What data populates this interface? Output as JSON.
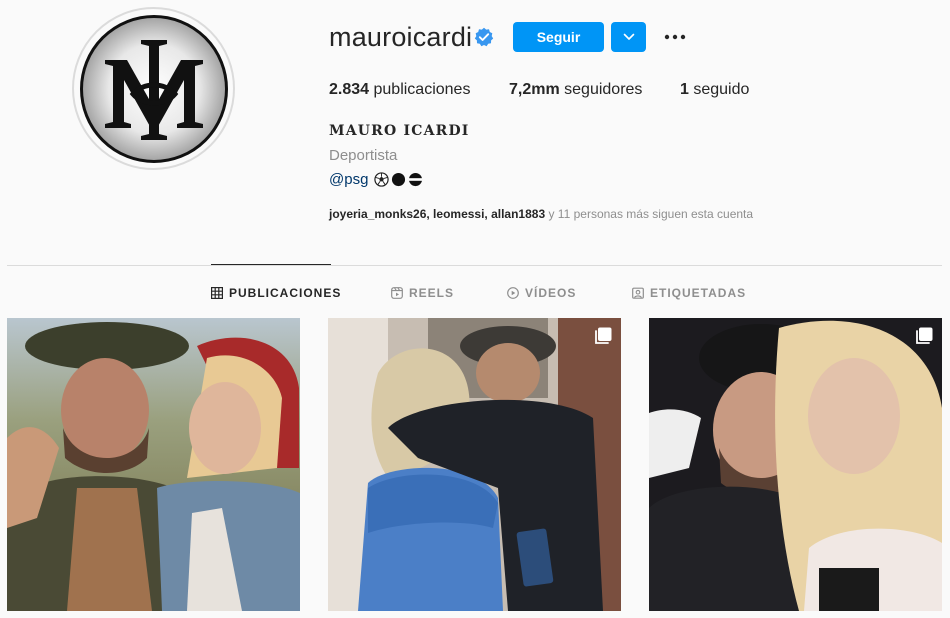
{
  "profile": {
    "username": "mauroicardi",
    "full_name": "MAURO ICARDI",
    "category": "Deportista",
    "bio_link": "@psg",
    "bio_emoji": [
      "soccer-ball-icon",
      "black-circle-icon",
      "black-white-circle-icon"
    ],
    "avatar_icon": "mi-monogram-logo",
    "verified_icon": "verified-badge-icon"
  },
  "actions": {
    "follow_label": "Seguir",
    "suggest_icon": "chevron-down-icon",
    "more_icon": "more-options-icon"
  },
  "stats": {
    "posts_value": "2.834",
    "posts_label": " publicaciones",
    "followers_value": "7,2mm",
    "followers_label": " seguidores",
    "following_value": "1",
    "following_label": " seguido"
  },
  "followed_by": {
    "names": "joyeria_monks26, leomessi, allan1883",
    "suffix": " y 11 personas más siguen esta cuenta"
  },
  "tabs": [
    {
      "label": "PUBLICACIONES",
      "icon": "grid-icon",
      "active": true
    },
    {
      "label": "REELS",
      "icon": "reels-icon",
      "active": false
    },
    {
      "label": "VÍDEOS",
      "icon": "play-icon",
      "active": false
    },
    {
      "label": "ETIQUETADAS",
      "icon": "tagged-icon",
      "active": false
    }
  ],
  "posts": [
    {
      "multi": false,
      "icon": ""
    },
    {
      "multi": true,
      "icon": "carousel-icon"
    },
    {
      "multi": true,
      "icon": "carousel-icon"
    }
  ],
  "colors": {
    "accent": "#0095f6",
    "background": "#fafafa",
    "text": "#262626",
    "muted": "#8e8e8e",
    "link": "#00376b"
  }
}
